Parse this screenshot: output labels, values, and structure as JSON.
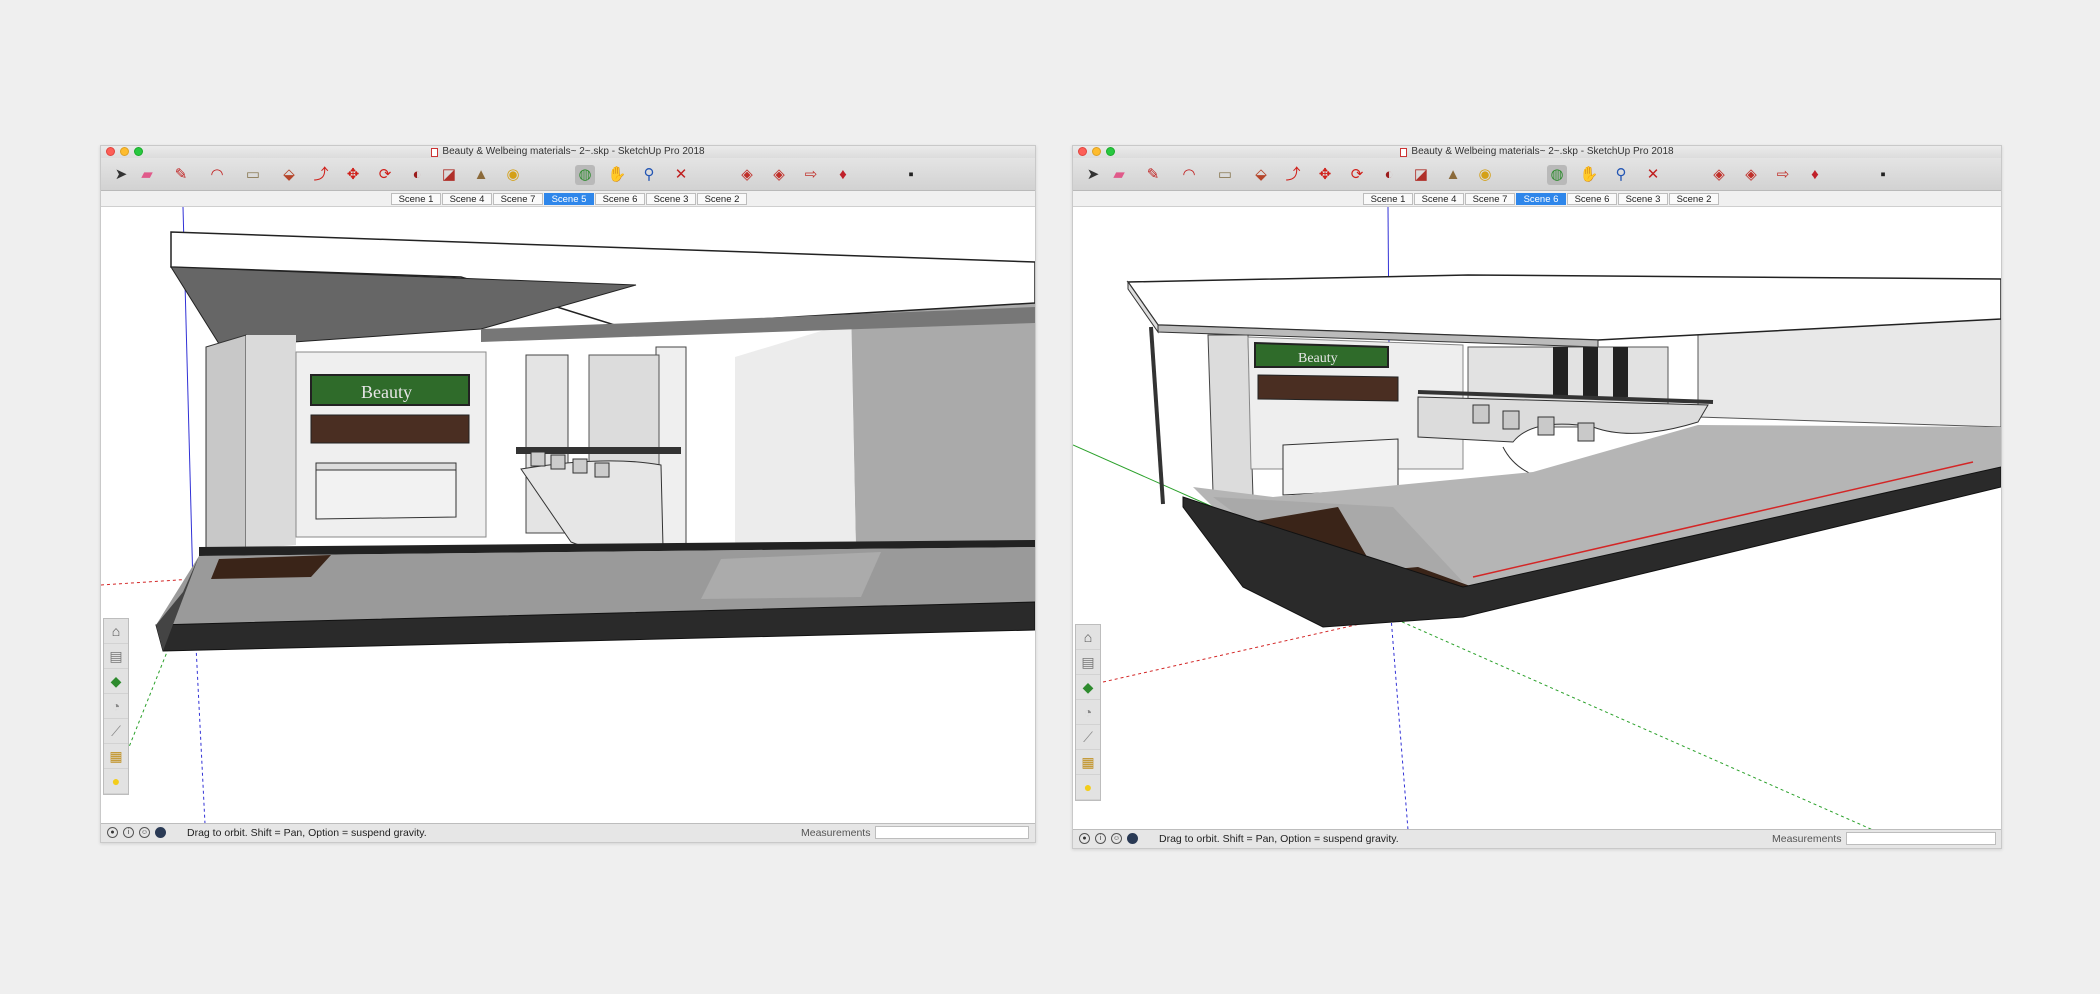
{
  "colors": {
    "active_tab": "#2e86ea",
    "red_axis": "#d32626",
    "green_axis": "#2ba12b",
    "blue_axis": "#3131d6"
  },
  "windows": [
    {
      "title": "Beauty & Welbeing materials~ 2~.skp - SketchUp Pro 2018",
      "active_scene": "Scene 5",
      "scenes": [
        {
          "label": "Scene 1"
        },
        {
          "label": "Scene 4"
        },
        {
          "label": "Scene 7"
        },
        {
          "label": "Scene 5"
        },
        {
          "label": "Scene 6"
        },
        {
          "label": "Scene 3"
        },
        {
          "label": "Scene 2"
        }
      ],
      "sign_text": "Beauty",
      "status_text": "Drag to orbit. Shift = Pan, Option = suspend gravity.",
      "measurements_label": "Measurements",
      "measurements_value": ""
    },
    {
      "title": "Beauty & Welbeing materials~ 2~.skp - SketchUp Pro 2018",
      "active_scene": "Scene 6",
      "scenes": [
        {
          "label": "Scene 1"
        },
        {
          "label": "Scene 4"
        },
        {
          "label": "Scene 7"
        },
        {
          "label": "Scene 6"
        },
        {
          "label": "Scene 6"
        },
        {
          "label": "Scene 3"
        },
        {
          "label": "Scene 2"
        }
      ],
      "sign_text": "Beauty",
      "status_text": "Drag to orbit. Shift = Pan, Option = suspend gravity.",
      "measurements_label": "Measurements",
      "measurements_value": ""
    }
  ],
  "toolbar_tools": [
    {
      "name": "select-arrow-icon",
      "glyph": "➤"
    },
    {
      "name": "eraser-icon",
      "glyph": "▰"
    },
    {
      "name": "pencil-line-icon",
      "glyph": "✎"
    },
    {
      "name": "arc-icon",
      "glyph": "◠"
    },
    {
      "name": "rectangle-icon",
      "glyph": "▭"
    },
    {
      "name": "push-pull-icon",
      "glyph": "⬙"
    },
    {
      "name": "offset-icon",
      "glyph": "⤴"
    },
    {
      "name": "move-icon",
      "glyph": "✥"
    },
    {
      "name": "rotate-icon",
      "glyph": "⟳"
    },
    {
      "name": "follow-me-icon",
      "glyph": "◐"
    },
    {
      "name": "scale-icon",
      "glyph": "◪"
    },
    {
      "name": "tape-measure-icon",
      "glyph": "▲"
    },
    {
      "name": "paint-bucket-icon",
      "glyph": "◉"
    },
    {
      "name": "orbit-icon",
      "glyph": "◍"
    },
    {
      "name": "pan-icon",
      "glyph": "✋"
    },
    {
      "name": "zoom-icon",
      "glyph": "⚲"
    },
    {
      "name": "zoom-extents-icon",
      "glyph": "✕"
    },
    {
      "name": "warehouse-icon",
      "glyph": "◈"
    },
    {
      "name": "extension-warehouse-icon",
      "glyph": "◈"
    },
    {
      "name": "send-to-layout-icon",
      "glyph": "⇨"
    },
    {
      "name": "extension-manager-icon",
      "glyph": "♦"
    },
    {
      "name": "style-toggle-icon",
      "glyph": "▪"
    }
  ],
  "left_tools": [
    {
      "name": "standard-views-icon",
      "glyph": "⌂"
    },
    {
      "name": "section-plane-icon",
      "glyph": "▤"
    },
    {
      "name": "materials-icon",
      "glyph": "◆"
    },
    {
      "name": "shadows-icon",
      "glyph": "◔"
    },
    {
      "name": "dimension-icon",
      "glyph": "⟋"
    },
    {
      "name": "layers-icon",
      "glyph": "▦"
    },
    {
      "name": "light-bulb-icon",
      "glyph": "●"
    }
  ]
}
